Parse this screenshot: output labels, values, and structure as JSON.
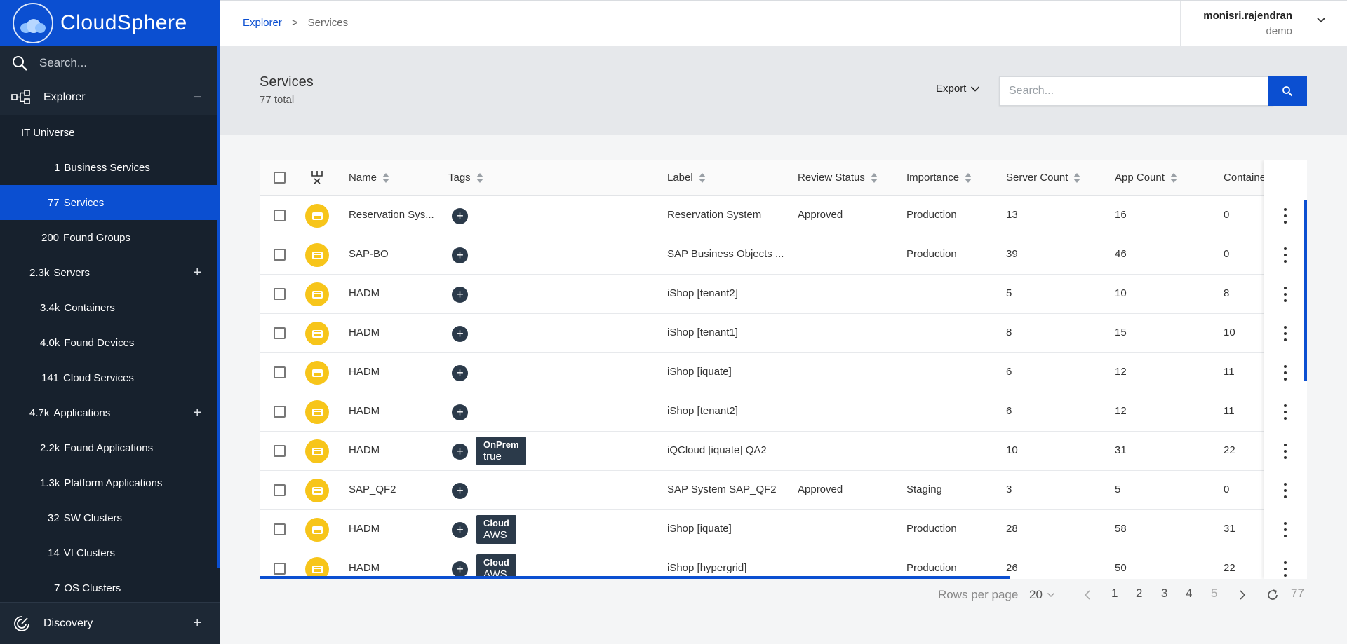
{
  "sidebar": {
    "brand": "CloudSphere",
    "search_placeholder": "Search...",
    "explorer_label": "Explorer",
    "items": [
      {
        "count": "",
        "label": "IT Universe"
      },
      {
        "count": "1",
        "label": "Business Services"
      },
      {
        "count": "77",
        "label": "Services"
      },
      {
        "count": "200",
        "label": "Found Groups"
      },
      {
        "count": "2.3k",
        "label": "Servers"
      },
      {
        "count": "3.4k",
        "label": "Containers"
      },
      {
        "count": "4.0k",
        "label": "Found Devices"
      },
      {
        "count": "141",
        "label": "Cloud Services"
      },
      {
        "count": "4.7k",
        "label": "Applications"
      },
      {
        "count": "2.2k",
        "label": "Found Applications"
      },
      {
        "count": "1.3k",
        "label": "Platform Applications"
      },
      {
        "count": "32",
        "label": "SW Clusters"
      },
      {
        "count": "14",
        "label": "VI Clusters"
      },
      {
        "count": "7",
        "label": "OS Clusters"
      }
    ],
    "discovery_label": "Discovery"
  },
  "topbar": {
    "breadcrumb_root": "Explorer",
    "breadcrumb_sep": ">",
    "breadcrumb_current": "Services",
    "username": "monisri.rajendran",
    "tenant": "demo"
  },
  "page": {
    "title": "Services",
    "total": "77 total",
    "export_label": "Export",
    "search_placeholder": "Search..."
  },
  "table": {
    "columns": [
      "Name",
      "Tags",
      "Label",
      "Review Status",
      "Importance",
      "Server Count",
      "App Count",
      "Containe"
    ],
    "rows": [
      {
        "name": "Reservation Sys...",
        "tag_key": "",
        "tag_value": "",
        "label": "Reservation System",
        "review": "Approved",
        "importance": "Production",
        "servers": "13",
        "apps": "16",
        "containers": "0"
      },
      {
        "name": "SAP-BO",
        "tag_key": "",
        "tag_value": "",
        "label": "SAP Business Objects ...",
        "review": "",
        "importance": "Production",
        "servers": "39",
        "apps": "46",
        "containers": "0"
      },
      {
        "name": "HADM",
        "tag_key": "",
        "tag_value": "",
        "label": "iShop [tenant2]",
        "review": "",
        "importance": "",
        "servers": "5",
        "apps": "10",
        "containers": "8"
      },
      {
        "name": "HADM",
        "tag_key": "",
        "tag_value": "",
        "label": "iShop [tenant1]",
        "review": "",
        "importance": "",
        "servers": "8",
        "apps": "15",
        "containers": "10"
      },
      {
        "name": "HADM",
        "tag_key": "",
        "tag_value": "",
        "label": "iShop [iquate]",
        "review": "",
        "importance": "",
        "servers": "6",
        "apps": "12",
        "containers": "11"
      },
      {
        "name": "HADM",
        "tag_key": "",
        "tag_value": "",
        "label": "iShop [tenant2]",
        "review": "",
        "importance": "",
        "servers": "6",
        "apps": "12",
        "containers": "11"
      },
      {
        "name": "HADM",
        "tag_key": "OnPrem",
        "tag_value": "true",
        "label": "iQCloud [iquate] QA2",
        "review": "",
        "importance": "",
        "servers": "10",
        "apps": "31",
        "containers": "22"
      },
      {
        "name": "SAP_QF2",
        "tag_key": "",
        "tag_value": "",
        "label": "SAP System SAP_QF2",
        "review": "Approved",
        "importance": "Staging",
        "servers": "3",
        "apps": "5",
        "containers": "0"
      },
      {
        "name": "HADM",
        "tag_key": "Cloud",
        "tag_value": "AWS",
        "label": "iShop [iquate]",
        "review": "",
        "importance": "Production",
        "servers": "28",
        "apps": "58",
        "containers": "31"
      },
      {
        "name": "HADM",
        "tag_key": "Cloud",
        "tag_value": "AWS",
        "label": "iShop [hypergrid]",
        "review": "",
        "importance": "Production",
        "servers": "26",
        "apps": "50",
        "containers": "22"
      }
    ]
  },
  "pagination": {
    "rows_per_page_label": "Rows per page",
    "rows_per_page_value": "20",
    "pages": [
      "1",
      "2",
      "3",
      "4",
      "5"
    ],
    "total": "77"
  },
  "colors": {
    "brand_blue": "#0b4fd1",
    "sidebar_bg": "#17212d",
    "service_icon": "#f7c51a",
    "tag_chip": "#2b3a4a"
  }
}
